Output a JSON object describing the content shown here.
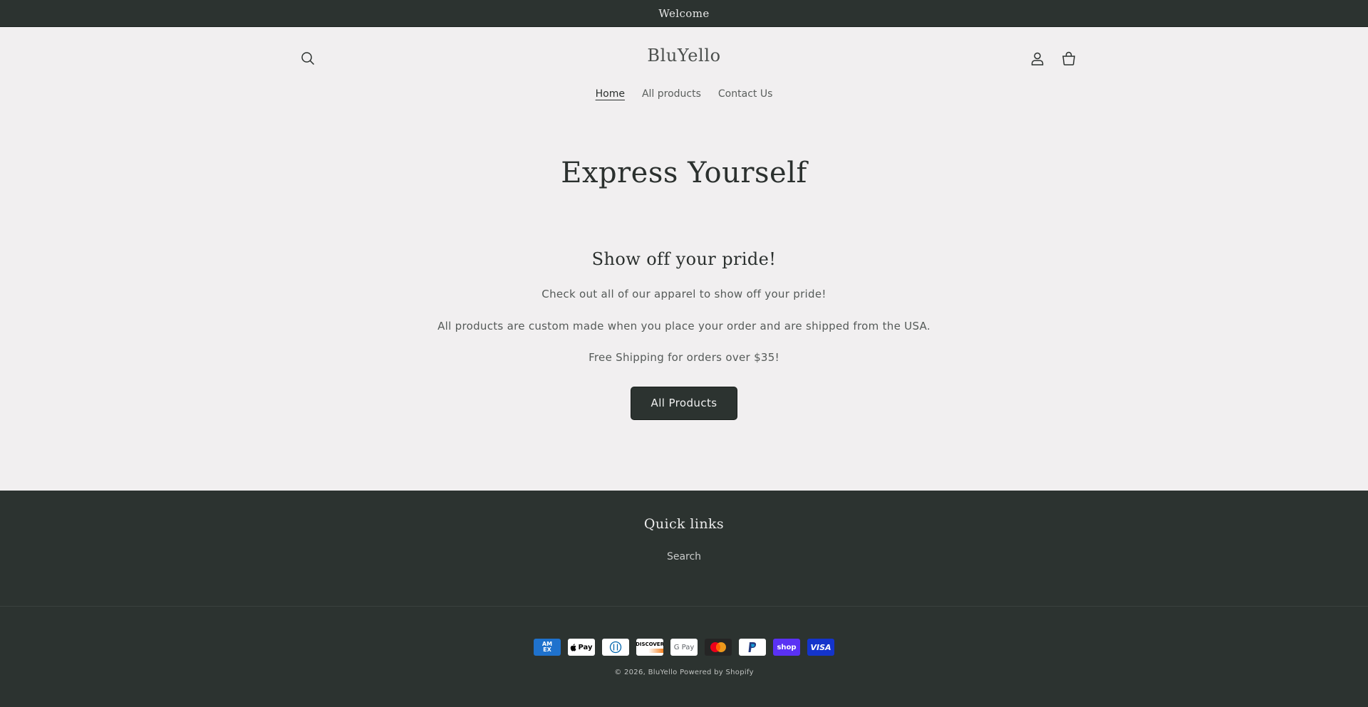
{
  "announcement": {
    "text": "Welcome"
  },
  "header": {
    "logo": "BluYello",
    "nav": [
      {
        "label": "Home",
        "active": true
      },
      {
        "label": "All products",
        "active": false
      },
      {
        "label": "Contact Us",
        "active": false
      }
    ],
    "icons": {
      "search": "search-icon",
      "account": "user-icon",
      "cart": "cart-icon"
    }
  },
  "hero": {
    "title": "Express Yourself"
  },
  "rich_text": {
    "heading": "Show off your pride!",
    "p1": "Check out all of our apparel to show off your pride!",
    "p2": "All products are custom made when you place your order and are shipped from the USA.",
    "p3": "Free Shipping for orders over $35!",
    "button": "All Products"
  },
  "footer": {
    "quick_links_title": "Quick links",
    "quick_links": [
      {
        "label": "Search"
      }
    ],
    "payments": [
      "American Express",
      "Apple Pay",
      "Diners Club",
      "Discover",
      "Google Pay",
      "Mastercard",
      "PayPal",
      "Shop Pay",
      "Visa"
    ],
    "payment_labels": {
      "amex_top": "AM",
      "amex_bottom": "EX",
      "apple": "Pay",
      "discover": "DISCOVER",
      "gpay": "G Pay",
      "shop": "shop",
      "visa": "VISA"
    },
    "copyright": "© 2026,",
    "brand": "BluYello",
    "powered": "Powered by Shopify"
  },
  "colors": {
    "dark": "#2c3330",
    "background": "#f1eff0",
    "shop_pay": "#5a31f4",
    "visa": "#1434cb",
    "amex": "#1f72cd"
  }
}
